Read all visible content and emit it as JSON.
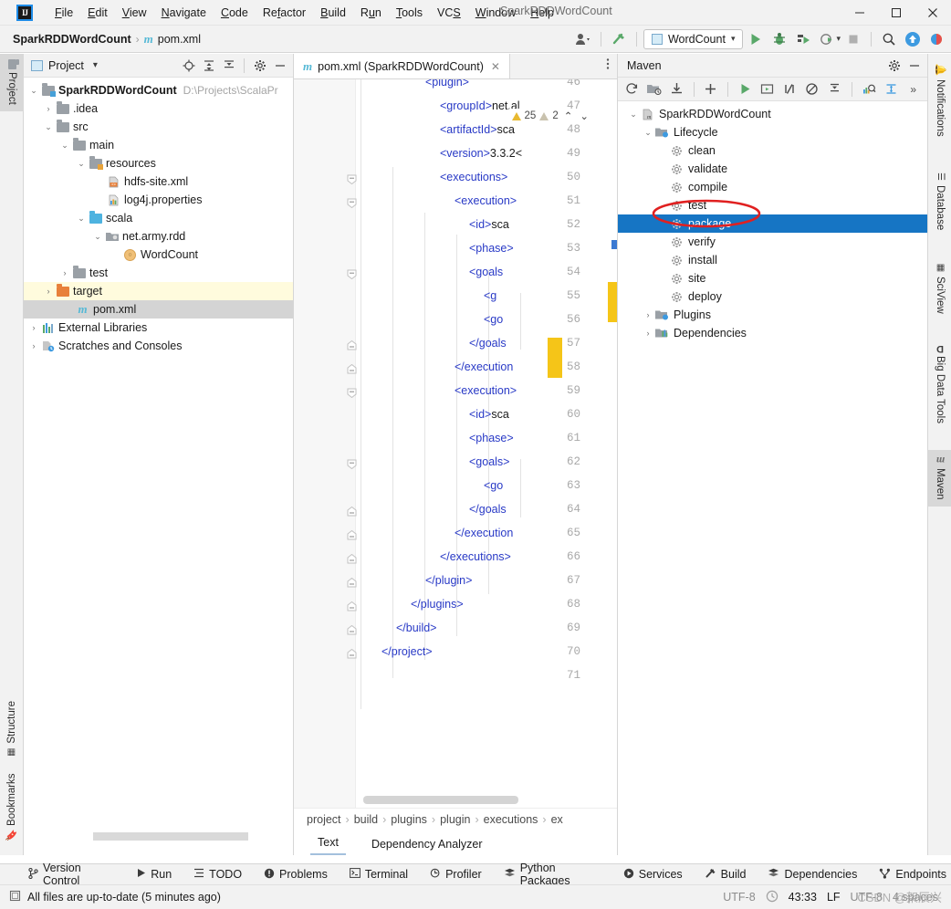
{
  "window": {
    "title": "SparkRDDWordCount",
    "logo": "intellij-idea-logo",
    "minimize": "–",
    "maximize": "☐",
    "close": "✕"
  },
  "menu": [
    {
      "label": "File"
    },
    {
      "label": "Edit"
    },
    {
      "label": "View"
    },
    {
      "label": "Navigate"
    },
    {
      "label": "Code"
    },
    {
      "label": "Refactor"
    },
    {
      "label": "Build"
    },
    {
      "label": "Run"
    },
    {
      "label": "Tools"
    },
    {
      "label": "VCS"
    },
    {
      "label": "Window"
    },
    {
      "label": "Help"
    }
  ],
  "toolbar": {
    "breadcrumb_project": "SparkRDDWordCount",
    "breadcrumb_sep": "›",
    "breadcrumb_file": "pom.xml",
    "run_config": "WordCount",
    "icons": [
      "user-icon",
      "hammer-build-icon",
      "run-icon",
      "debug-icon",
      "run-coverage-icon",
      "profiler-icon",
      "stop-icon",
      "search-everywhere-icon",
      "update-icon",
      "ide-feature-icon"
    ]
  },
  "left_strip": {
    "top": [
      {
        "label": "Project",
        "icon": "project-folder-icon",
        "selected": true
      }
    ],
    "bottom": [
      {
        "label": "Structure",
        "icon": "structure-icon",
        "selected": false
      },
      {
        "label": "Bookmarks",
        "icon": "bookmark-icon",
        "selected": false
      }
    ]
  },
  "right_strip": [
    {
      "label": "Notifications",
      "icon": "bell-icon"
    },
    {
      "label": "Database",
      "icon": "database-icon"
    },
    {
      "label": "SciView",
      "icon": "sciview-grid-icon"
    },
    {
      "label": "Big Data Tools",
      "icon": "big-data-tools-icon"
    },
    {
      "label": "Maven",
      "icon": "maven-m-icon",
      "selected": true
    }
  ],
  "project_panel": {
    "title": "Project",
    "dropdown": "▾",
    "header_icons": [
      "locate-icon",
      "expand-all-icon",
      "collapse-all-icon",
      "gear-icon",
      "minimize-icon"
    ],
    "tree": [
      {
        "depth": 0,
        "arrow": "⌄",
        "icon": "module-folder-icon",
        "label": "SparkRDDWordCount",
        "bold": true,
        "path": "D:\\Projects\\ScalaPr",
        "state": "none"
      },
      {
        "depth": 1,
        "arrow": "›",
        "icon": "folder-icon",
        "label": ".idea",
        "state": "none"
      },
      {
        "depth": 1,
        "arrow": "⌄",
        "icon": "folder-icon",
        "label": "src",
        "state": "none"
      },
      {
        "depth": 2,
        "arrow": "⌄",
        "icon": "folder-icon",
        "label": "main",
        "state": "none"
      },
      {
        "depth": 3,
        "arrow": "⌄",
        "icon": "resources-folder-icon",
        "label": "resources",
        "state": "none"
      },
      {
        "depth": 4,
        "arrow": "",
        "icon": "xml-file-icon",
        "label": "hdfs-site.xml",
        "state": "none"
      },
      {
        "depth": 4,
        "arrow": "",
        "icon": "properties-file-icon",
        "label": "log4j.properties",
        "state": "none"
      },
      {
        "depth": 3,
        "arrow": "⌄",
        "icon": "sources-folder-icon",
        "label": "scala",
        "state": "none"
      },
      {
        "depth": 4,
        "arrow": "⌄",
        "icon": "package-folder-icon",
        "label": "net.army.rdd",
        "state": "none"
      },
      {
        "depth": 5,
        "arrow": "",
        "icon": "scala-object-icon",
        "label": "WordCount",
        "state": "none"
      },
      {
        "depth": 2,
        "arrow": "›",
        "icon": "folder-icon",
        "label": "test",
        "state": "none"
      },
      {
        "depth": 1,
        "arrow": "›",
        "icon": "excluded-folder-icon",
        "label": "target",
        "state": "highlight"
      },
      {
        "depth": 1,
        "arrow": "",
        "icon": "maven-pom-icon",
        "label": "pom.xml",
        "state": "selected"
      },
      {
        "depth": 0,
        "arrow": "›",
        "icon": "libraries-icon",
        "label": "External Libraries",
        "state": "none"
      },
      {
        "depth": 0,
        "arrow": "›",
        "icon": "scratches-icon",
        "label": "Scratches and Consoles",
        "state": "none"
      }
    ]
  },
  "editor": {
    "tab": {
      "label": "pom.xml (SparkRDDWordCount)",
      "icon": "maven-pom-icon",
      "close": "✕"
    },
    "tab_options": "⋮",
    "inspections": {
      "warnings": "25",
      "weak_warnings": "2",
      "prev": "⌃",
      "next": "⌄"
    },
    "first_line": 46,
    "lines": [
      {
        "n": 46,
        "indent": 18,
        "text": "<plugin>",
        "fold": "none",
        "clipped": true
      },
      {
        "n": 47,
        "indent": 20,
        "text": "<groupId>net.al",
        "fold": "none",
        "clipped": true
      },
      {
        "n": 48,
        "indent": 20,
        "text": "<artifactId>sca",
        "fold": "none",
        "clipped": true
      },
      {
        "n": 49,
        "indent": 20,
        "text": "<version>3.3.2<",
        "fold": "none",
        "clipped": true
      },
      {
        "n": 50,
        "indent": 20,
        "text": "<executions>",
        "fold": "start",
        "clipped": false
      },
      {
        "n": 51,
        "indent": 22,
        "text": "<execution>",
        "fold": "start",
        "clipped": true
      },
      {
        "n": 52,
        "indent": 24,
        "text": "<id>sca",
        "fold": "none",
        "clipped": true
      },
      {
        "n": 53,
        "indent": 24,
        "text": "<phase>",
        "fold": "none",
        "clipped": true
      },
      {
        "n": 54,
        "indent": 24,
        "text": "<goals",
        "fold": "start",
        "clipped": true
      },
      {
        "n": 55,
        "indent": 26,
        "text": "<g",
        "fold": "none",
        "clipped": true
      },
      {
        "n": 56,
        "indent": 26,
        "text": "<go",
        "fold": "none",
        "clipped": true
      },
      {
        "n": 57,
        "indent": 24,
        "text": "</goals",
        "fold": "end",
        "clipped": true
      },
      {
        "n": 58,
        "indent": 22,
        "text": "</execution",
        "fold": "end",
        "clipped": true
      },
      {
        "n": 59,
        "indent": 22,
        "text": "<execution>",
        "fold": "start",
        "clipped": true
      },
      {
        "n": 60,
        "indent": 24,
        "text": "<id>sca",
        "fold": "none",
        "clipped": true
      },
      {
        "n": 61,
        "indent": 24,
        "text": "<phase>",
        "fold": "none",
        "clipped": true
      },
      {
        "n": 62,
        "indent": 24,
        "text": "<goals>",
        "fold": "start",
        "clipped": true
      },
      {
        "n": 63,
        "indent": 26,
        "text": "<go",
        "fold": "none",
        "clipped": true
      },
      {
        "n": 64,
        "indent": 24,
        "text": "</goals",
        "fold": "end",
        "clipped": true
      },
      {
        "n": 65,
        "indent": 22,
        "text": "</execution",
        "fold": "end",
        "clipped": true
      },
      {
        "n": 66,
        "indent": 20,
        "text": "</executions>",
        "fold": "end",
        "clipped": false
      },
      {
        "n": 67,
        "indent": 18,
        "text": "</plugin>",
        "fold": "end",
        "clipped": false
      },
      {
        "n": 68,
        "indent": 16,
        "text": "</plugins>",
        "fold": "end",
        "clipped": false
      },
      {
        "n": 69,
        "indent": 14,
        "text": "</build>",
        "fold": "end",
        "clipped": false
      },
      {
        "n": 70,
        "indent": 12,
        "text": "</project>",
        "fold": "end",
        "clipped": false
      },
      {
        "n": 71,
        "indent": 12,
        "text": "",
        "fold": "none",
        "clipped": false
      }
    ],
    "breadcrumbs": [
      "project",
      "build",
      "plugins",
      "plugin",
      "executions",
      "ex"
    ],
    "bottom_tabs": [
      {
        "label": "Text",
        "active": true
      },
      {
        "label": "Dependency Analyzer",
        "active": false
      }
    ]
  },
  "maven_panel": {
    "title": "Maven",
    "header_icons": [
      "gear-icon",
      "minimize-icon"
    ],
    "toolbar_icons": [
      "reload-icon",
      "add-maven-projects-icon",
      "download-sources-icon",
      "plus-icon",
      "run-icon",
      "run-configuration-icon",
      "toggle-skip-tests-icon",
      "toggle-offline-icon",
      "collapse-all-icon",
      "profiler-icon",
      "expand-icon",
      "more-icon"
    ],
    "toolbar_more": "»",
    "tree": [
      {
        "depth": 0,
        "arrow": "⌄",
        "icon": "maven-project-icon",
        "label": "SparkRDDWordCount",
        "selected": false
      },
      {
        "depth": 1,
        "arrow": "⌄",
        "icon": "lifecycle-folder-icon",
        "label": "Lifecycle",
        "selected": false
      },
      {
        "depth": 2,
        "arrow": "",
        "icon": "gear-icon",
        "label": "clean",
        "selected": false
      },
      {
        "depth": 2,
        "arrow": "",
        "icon": "gear-icon",
        "label": "validate",
        "selected": false
      },
      {
        "depth": 2,
        "arrow": "",
        "icon": "gear-icon",
        "label": "compile",
        "selected": false
      },
      {
        "depth": 2,
        "arrow": "",
        "icon": "gear-icon",
        "label": "test",
        "selected": false
      },
      {
        "depth": 2,
        "arrow": "",
        "icon": "gear-icon",
        "label": "package",
        "selected": true,
        "annotated": true
      },
      {
        "depth": 2,
        "arrow": "",
        "icon": "gear-icon",
        "label": "verify",
        "selected": false
      },
      {
        "depth": 2,
        "arrow": "",
        "icon": "gear-icon",
        "label": "install",
        "selected": false
      },
      {
        "depth": 2,
        "arrow": "",
        "icon": "gear-icon",
        "label": "site",
        "selected": false
      },
      {
        "depth": 2,
        "arrow": "",
        "icon": "gear-icon",
        "label": "deploy",
        "selected": false
      },
      {
        "depth": 1,
        "arrow": "›",
        "icon": "plugins-folder-icon",
        "label": "Plugins",
        "selected": false
      },
      {
        "depth": 1,
        "arrow": "›",
        "icon": "dependencies-folder-icon",
        "label": "Dependencies",
        "selected": false
      }
    ],
    "annotation_color": "#e02020"
  },
  "tool_window_bar": [
    {
      "label": "Version Control",
      "icon": "branch-icon"
    },
    {
      "label": "Run",
      "icon": "run-icon"
    },
    {
      "label": "TODO",
      "icon": "todo-list-icon"
    },
    {
      "label": "Problems",
      "icon": "problems-icon"
    },
    {
      "label": "Terminal",
      "icon": "terminal-icon"
    },
    {
      "label": "Profiler",
      "icon": "profiler-icon"
    },
    {
      "label": "Python Packages",
      "icon": "python-packages-icon"
    },
    {
      "label": "Services",
      "icon": "services-icon"
    },
    {
      "label": "Build",
      "icon": "build-hammer-icon"
    },
    {
      "label": "Dependencies",
      "icon": "dependencies-icon"
    },
    {
      "label": "Endpoints",
      "icon": "endpoints-icon"
    }
  ],
  "status_bar": {
    "icon": "file-sync-icon",
    "message": "All files are up-to-date (5 minutes ago)",
    "encoding": "UTF-8",
    "inspection_icon": "inspection-level-icon",
    "caret": "43:33",
    "line_separator": "LF",
    "encoding_right": "UTF-8",
    "indent": "4 spaces",
    "watermark": "CSDN @架辰兴"
  },
  "colors": {
    "accent_blue": "#1675c4",
    "tag_blue": "#2839c6",
    "highlight_yellow": "#f5c518",
    "target_row": "#fffbdd",
    "annotation_red": "#e02020"
  }
}
